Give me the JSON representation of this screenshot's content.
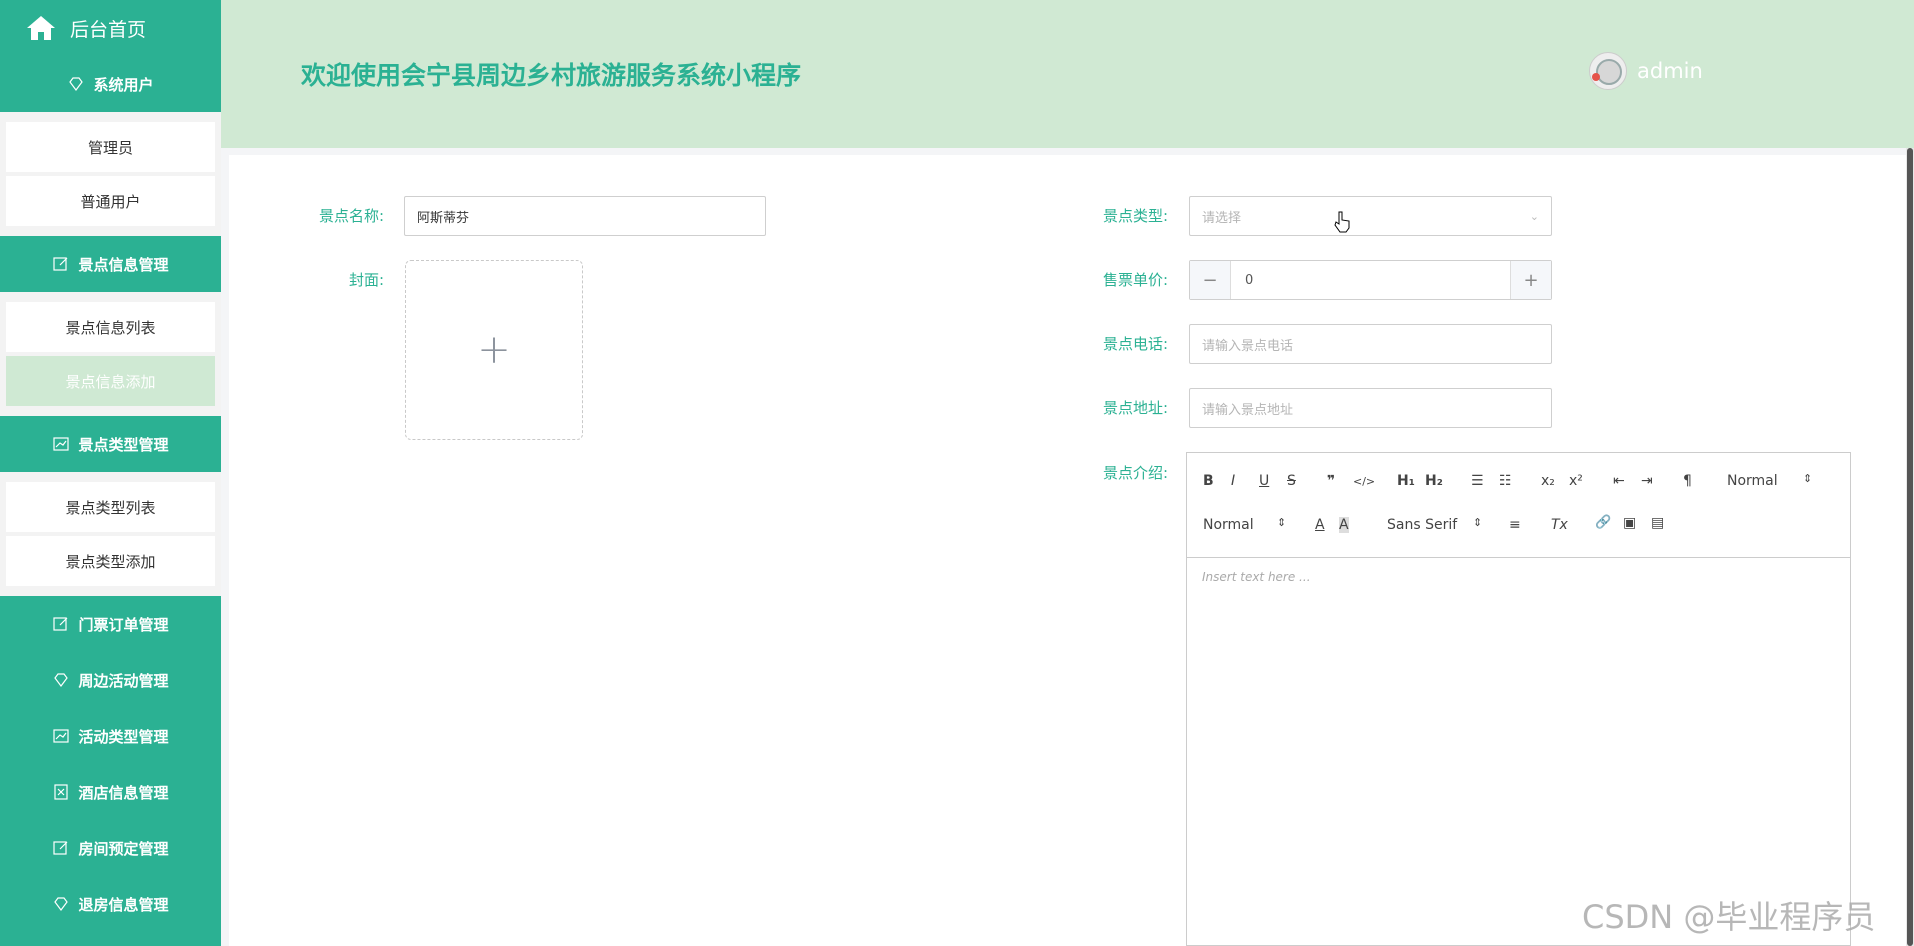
{
  "sidebar": {
    "home": {
      "label": "后台首页"
    },
    "groups": [
      {
        "label": "系统用户",
        "icon": "diamond-icon",
        "items": [
          "管理员",
          "普通用户"
        ]
      },
      {
        "label": "景点信息管理",
        "icon": "edit-icon",
        "items": [
          "景点信息列表",
          "景点信息添加"
        ],
        "active_item": "景点信息添加"
      },
      {
        "label": "景点类型管理",
        "icon": "chart-icon",
        "items": [
          "景点类型列表",
          "景点类型添加"
        ]
      },
      {
        "label": "门票订单管理",
        "icon": "edit-icon"
      },
      {
        "label": "周边活动管理",
        "icon": "diamond-icon"
      },
      {
        "label": "活动类型管理",
        "icon": "chart-icon"
      },
      {
        "label": "酒店信息管理",
        "icon": "doc-icon"
      },
      {
        "label": "房间预定管理",
        "icon": "edit-icon"
      },
      {
        "label": "退房信息管理",
        "icon": "diamond-icon"
      }
    ]
  },
  "header": {
    "title": "欢迎使用会宁县周边乡村旅游服务系统小程序",
    "username": "admin"
  },
  "form": {
    "name": {
      "label": "景点名称:",
      "value": "阿斯蒂芬"
    },
    "cover": {
      "label": "封面:",
      "icon": "plus-icon"
    },
    "type": {
      "label": "景点类型:",
      "placeholder": "请选择"
    },
    "price": {
      "label": "售票单价:",
      "value": "0",
      "minus": "−",
      "plus": "+"
    },
    "phone": {
      "label": "景点电话:",
      "placeholder": "请输入景点电话"
    },
    "address": {
      "label": "景点地址:",
      "placeholder": "请输入景点地址"
    },
    "intro": {
      "label": "景点介绍:",
      "placeholder": "Insert text here ...",
      "toolbar": {
        "bold": "B",
        "italic": "I",
        "underline": "U",
        "strike": "S",
        "quote": "❞",
        "code": "</>",
        "h1": "H₁",
        "h2": "H₂",
        "ol": "☰",
        "ul": "☷",
        "sub": "x₂",
        "sup": "x²",
        "outdent": "⇤",
        "indent": "⇥",
        "dir": "¶",
        "header_select": "Normal",
        "size_select": "Normal",
        "font_select": "Sans Serif",
        "color": "A",
        "bg": "A",
        "align": "≡",
        "clean": "Tx",
        "link": "🔗",
        "image": "▣",
        "video": "▤"
      }
    }
  },
  "watermark": "CSDN @毕业程序员",
  "colors": {
    "primary": "#2bb193",
    "header_bg": "#d0e9d3"
  }
}
